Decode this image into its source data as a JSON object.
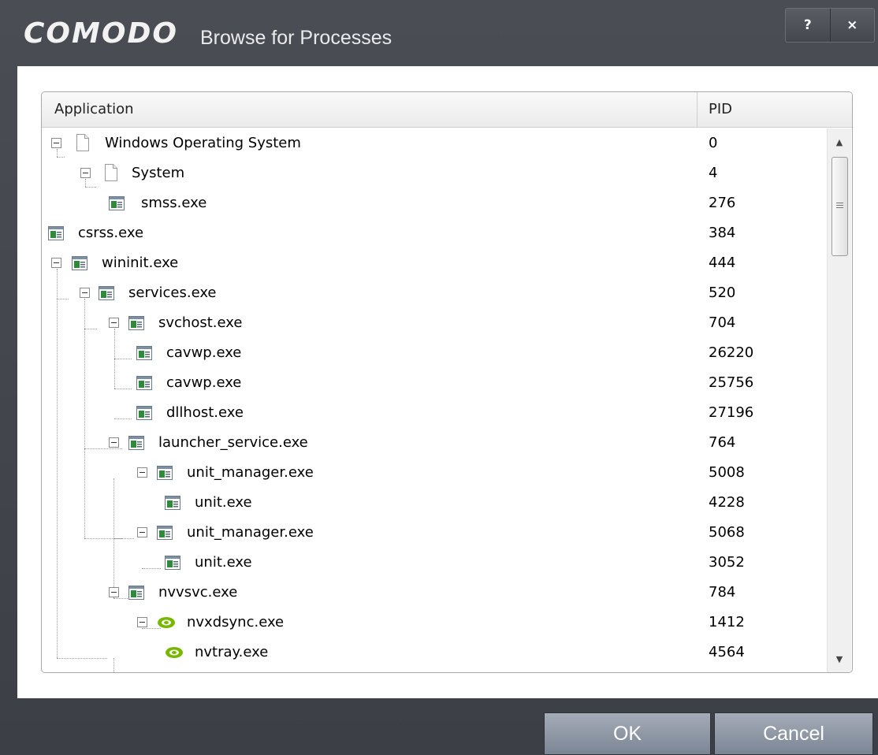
{
  "dialog": {
    "brand": "COMODO",
    "title": "Browse for Processes",
    "help_label": "?",
    "close_label": "×"
  },
  "table": {
    "columns": [
      "Application",
      "PID"
    ],
    "rows": [
      {
        "name": "Windows Operating System",
        "pid": "0",
        "icon": "document-icon"
      },
      {
        "name": "System",
        "pid": "4",
        "icon": "document-icon"
      },
      {
        "name": "smss.exe",
        "pid": "276",
        "icon": "application-icon"
      },
      {
        "name": "csrss.exe",
        "pid": "384",
        "icon": "application-icon"
      },
      {
        "name": "wininit.exe",
        "pid": "444",
        "icon": "application-icon"
      },
      {
        "name": "services.exe",
        "pid": "520",
        "icon": "application-icon"
      },
      {
        "name": "svchost.exe",
        "pid": "704",
        "icon": "application-icon"
      },
      {
        "name": "cavwp.exe",
        "pid": "26220",
        "icon": "application-icon"
      },
      {
        "name": "cavwp.exe",
        "pid": "25756",
        "icon": "application-icon"
      },
      {
        "name": "dllhost.exe",
        "pid": "27196",
        "icon": "application-icon"
      },
      {
        "name": "launcher_service.exe",
        "pid": "764",
        "icon": "application-icon"
      },
      {
        "name": "unit_manager.exe",
        "pid": "5008",
        "icon": "application-icon"
      },
      {
        "name": "unit.exe",
        "pid": "4228",
        "icon": "application-icon"
      },
      {
        "name": "unit_manager.exe",
        "pid": "5068",
        "icon": "application-icon"
      },
      {
        "name": "unit.exe",
        "pid": "3052",
        "icon": "application-icon"
      },
      {
        "name": "nvvsvc.exe",
        "pid": "784",
        "icon": "application-icon"
      },
      {
        "name": "nvxdsync.exe",
        "pid": "1412",
        "icon": "nvidia-icon"
      },
      {
        "name": "nvtray.exe",
        "pid": "4564",
        "icon": "nvidia-icon"
      }
    ]
  },
  "buttons": {
    "ok": "OK",
    "cancel": "Cancel"
  },
  "colors": {
    "frame": "#43474d",
    "button": "#8a93a1",
    "nvidia_green": "#76b900"
  }
}
